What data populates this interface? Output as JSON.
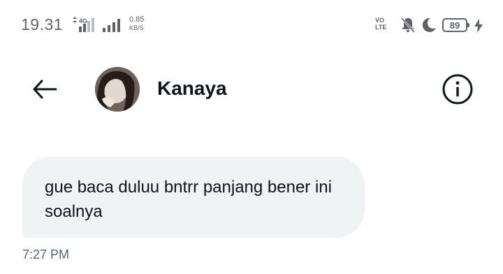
{
  "status_bar": {
    "time": "19.31",
    "network_type": "4G",
    "speed_value": "0.85",
    "speed_unit": "KB/S",
    "volte_top": "VO",
    "volte_bottom": "LTE",
    "battery_level": "89",
    "icons": [
      "data-arrows-icon",
      "signal-bars-icon",
      "volte-icon",
      "bell-off-icon",
      "moon-icon",
      "battery-icon",
      "charging-bolt-icon"
    ]
  },
  "header": {
    "back_icon": "arrow-left-icon",
    "contact_name": "Kanaya",
    "info_icon": "info-circle-icon"
  },
  "conversation": {
    "messages": [
      {
        "text": "gue baca duluu bntrr panjang bener ini soalnya",
        "time": "7:27 PM"
      }
    ]
  },
  "colors": {
    "bubble_bg": "#eff3f4",
    "text": "#0f1419",
    "timestamp": "#536471",
    "status_icons": "#5f6368"
  }
}
